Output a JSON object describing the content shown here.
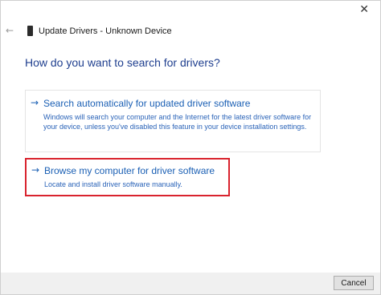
{
  "window": {
    "title": "Update Drivers - Unknown Device",
    "close_icon": "close-icon",
    "back_icon": "back-arrow-icon",
    "device_icon": "device-icon"
  },
  "question": "How do you want to search for drivers?",
  "options": [
    {
      "arrow": "→",
      "title": "Search automatically for updated driver software",
      "description": "Windows will search your computer and the Internet for the latest driver software for your device, unless you've disabled this feature in your device installation settings."
    },
    {
      "arrow": "→",
      "title": "Browse my computer for driver software",
      "description": "Locate and install driver software manually.",
      "highlight_color": "#d9232e"
    }
  ],
  "footer": {
    "cancel_label": "Cancel"
  },
  "colors": {
    "link": "#1a5fb4",
    "heading": "#1f3f8f",
    "highlight": "#d9232e"
  }
}
